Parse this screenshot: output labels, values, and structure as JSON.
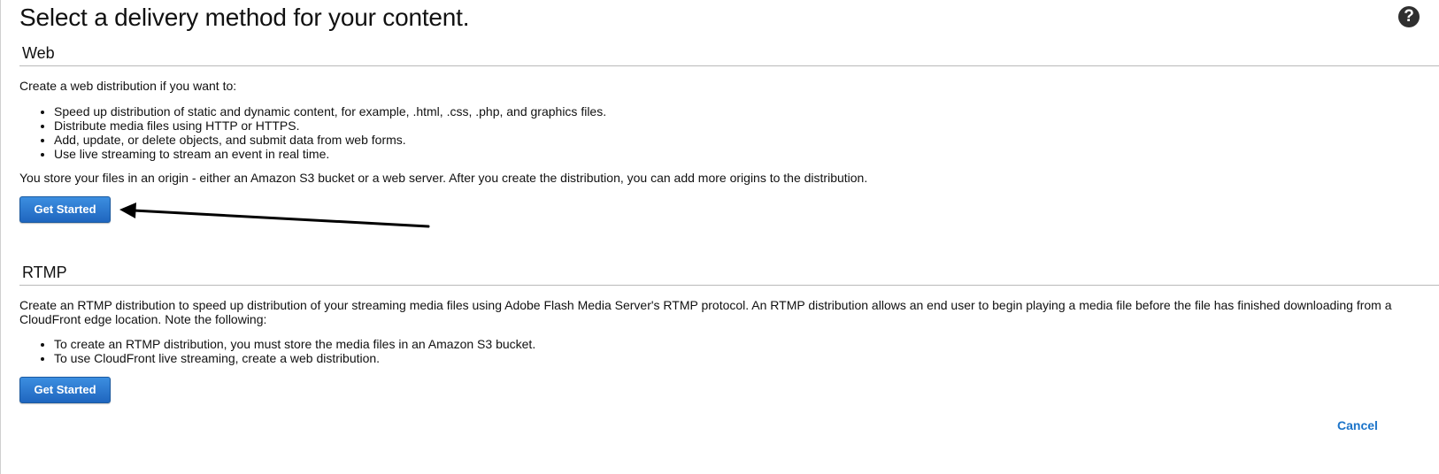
{
  "page": {
    "title": "Select a delivery method for your content.",
    "help_icon": "question-mark-icon"
  },
  "web": {
    "heading": "Web",
    "intro": "Create a web distribution if you want to:",
    "bullets": [
      "Speed up distribution of static and dynamic content, for example, .html, .css, .php, and graphics files.",
      "Distribute media files using HTTP or HTTPS.",
      "Add, update, or delete objects, and submit data from web forms.",
      "Use live streaming to stream an event in real time."
    ],
    "note": "You store your files in an origin - either an Amazon S3 bucket or a web server. After you create the distribution, you can add more origins to the distribution.",
    "button_label": "Get Started"
  },
  "rtmp": {
    "heading": "RTMP",
    "intro": "Create an RTMP distribution to speed up distribution of your streaming media files using Adobe Flash Media Server's RTMP protocol. An RTMP distribution allows an end user to begin playing a media file before the file has finished downloading from a CloudFront edge location. Note the following:",
    "bullets": [
      "To create an RTMP distribution, you must store the media files in an Amazon S3 bucket.",
      "To use CloudFront live streaming, create a web distribution."
    ],
    "button_label": "Get Started"
  },
  "footer": {
    "cancel_label": "Cancel"
  },
  "colors": {
    "button_top": "#3c8ee0",
    "button_bottom": "#1f66bf",
    "link": "#1a73c9",
    "annotation_arrow": "#000000"
  }
}
